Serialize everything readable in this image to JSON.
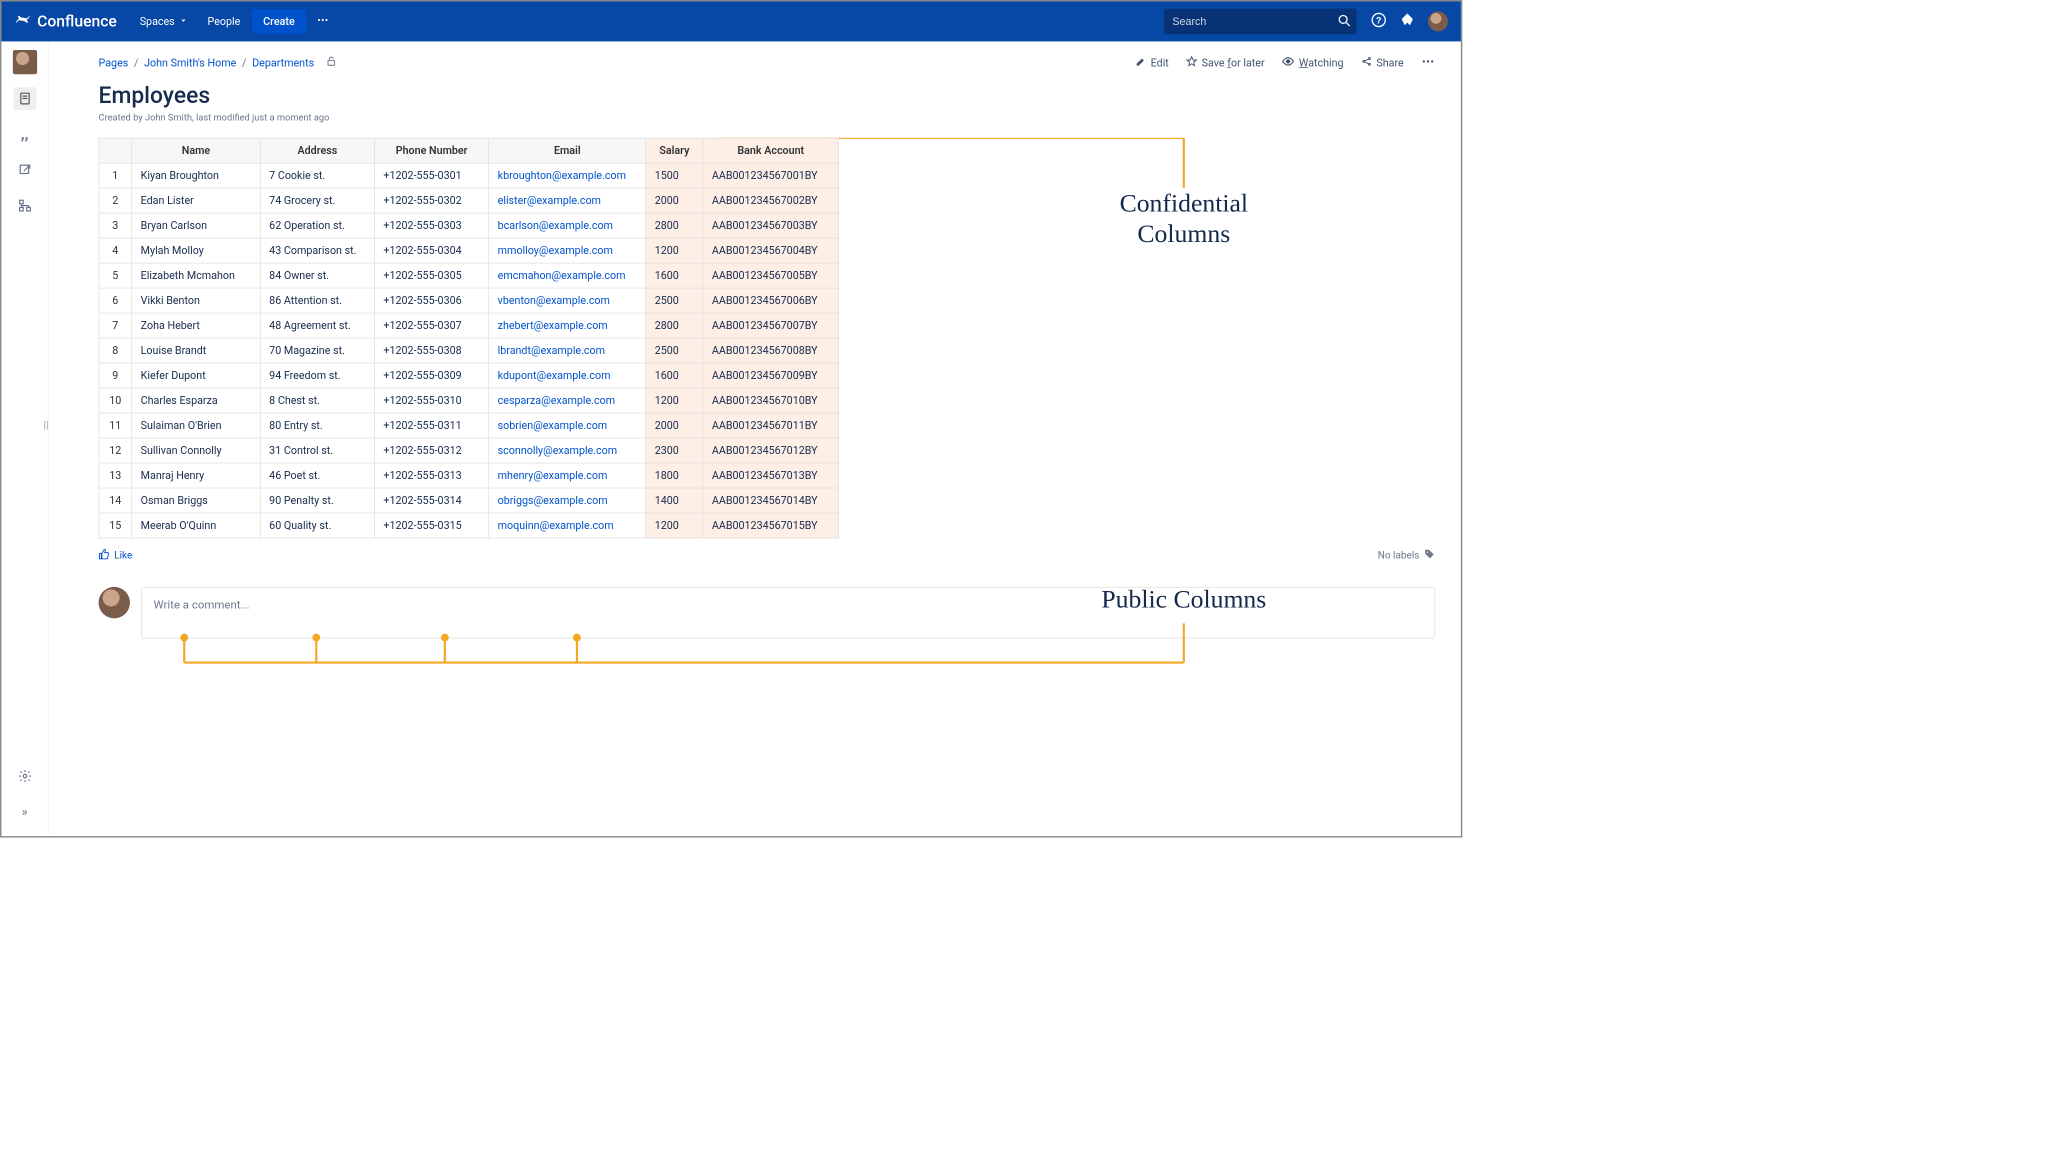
{
  "brand": "Confluence",
  "nav": {
    "spaces": "Spaces",
    "people": "People",
    "create": "Create"
  },
  "search": {
    "placeholder": "Search"
  },
  "breadcrumbs": {
    "root": "Pages",
    "home": "John Smith's Home",
    "section": "Departments"
  },
  "page": {
    "title": "Employees",
    "byline": "Created by John Smith, last modified just a moment ago"
  },
  "actions": {
    "edit": "Edit",
    "save": "Save for later",
    "watching": "Watching",
    "share": "Share"
  },
  "annotations": {
    "confidential_l1": "Confidential",
    "confidential_l2": "Columns",
    "public": "Public Columns"
  },
  "table": {
    "headers": {
      "name": "Name",
      "address": "Address",
      "phone": "Phone Number",
      "email": "Email",
      "salary": "Salary",
      "bank": "Bank Account"
    },
    "rows": [
      {
        "n": "1",
        "name": "Kiyan Broughton",
        "address": "7 Cookie st.",
        "phone": "+1202-555-0301",
        "email": "kbroughton@example.com",
        "salary": "1500",
        "bank": "AAB001234567001BY"
      },
      {
        "n": "2",
        "name": "Edan Lister",
        "address": "74 Grocery st.",
        "phone": "+1202-555-0302",
        "email": "elister@example.com",
        "salary": "2000",
        "bank": "AAB001234567002BY"
      },
      {
        "n": "3",
        "name": "Bryan Carlson",
        "address": "62 Operation st.",
        "phone": "+1202-555-0303",
        "email": "bcarlson@example.com",
        "salary": "2800",
        "bank": "AAB001234567003BY"
      },
      {
        "n": "4",
        "name": "Mylah Molloy",
        "address": "43 Comparison st.",
        "phone": "+1202-555-0304",
        "email": "mmolloy@example.com",
        "salary": "1200",
        "bank": "AAB001234567004BY"
      },
      {
        "n": "5",
        "name": "Elizabeth Mcmahon",
        "address": "84 Owner st.",
        "phone": "+1202-555-0305",
        "email": "emcmahon@example.com",
        "salary": "1600",
        "bank": "AAB001234567005BY"
      },
      {
        "n": "6",
        "name": "Vikki Benton",
        "address": "86 Attention st.",
        "phone": "+1202-555-0306",
        "email": "vbenton@example.com",
        "salary": "2500",
        "bank": "AAB001234567006BY"
      },
      {
        "n": "7",
        "name": "Zoha Hebert",
        "address": "48 Agreement st.",
        "phone": "+1202-555-0307",
        "email": "zhebert@example.com",
        "salary": "2800",
        "bank": "AAB001234567007BY"
      },
      {
        "n": "8",
        "name": "Louise Brandt",
        "address": "70 Magazine st.",
        "phone": "+1202-555-0308",
        "email": "lbrandt@example.com",
        "salary": "2500",
        "bank": "AAB001234567008BY"
      },
      {
        "n": "9",
        "name": "Kiefer Dupont",
        "address": "94 Freedom st.",
        "phone": "+1202-555-0309",
        "email": "kdupont@example.com",
        "salary": "1600",
        "bank": "AAB001234567009BY"
      },
      {
        "n": "10",
        "name": "Charles Esparza",
        "address": "8 Chest st.",
        "phone": "+1202-555-0310",
        "email": "cesparza@example.com",
        "salary": "1200",
        "bank": "AAB001234567010BY"
      },
      {
        "n": "11",
        "name": "Sulaiman O'Brien",
        "address": "80 Entry st.",
        "phone": "+1202-555-0311",
        "email": "sobrien@example.com",
        "salary": "2000",
        "bank": "AAB001234567011BY"
      },
      {
        "n": "12",
        "name": "Sullivan Connolly",
        "address": "31 Control st.",
        "phone": "+1202-555-0312",
        "email": "sconnolly@example.com",
        "salary": "2300",
        "bank": "AAB001234567012BY"
      },
      {
        "n": "13",
        "name": "Manraj Henry",
        "address": "46 Poet st.",
        "phone": "+1202-555-0313",
        "email": "mhenry@example.com",
        "salary": "1800",
        "bank": "AAB001234567013BY"
      },
      {
        "n": "14",
        "name": "Osman Briggs",
        "address": "90 Penalty st.",
        "phone": "+1202-555-0314",
        "email": "obriggs@example.com",
        "salary": "1400",
        "bank": "AAB001234567014BY"
      },
      {
        "n": "15",
        "name": "Meerab O'Quinn",
        "address": "60 Quality st.",
        "phone": "+1202-555-0315",
        "email": "moquinn@example.com",
        "salary": "1200",
        "bank": "AAB001234567015BY"
      }
    ]
  },
  "footer": {
    "like": "Like",
    "nolabels": "No labels",
    "comment_placeholder": "Write a comment..."
  }
}
